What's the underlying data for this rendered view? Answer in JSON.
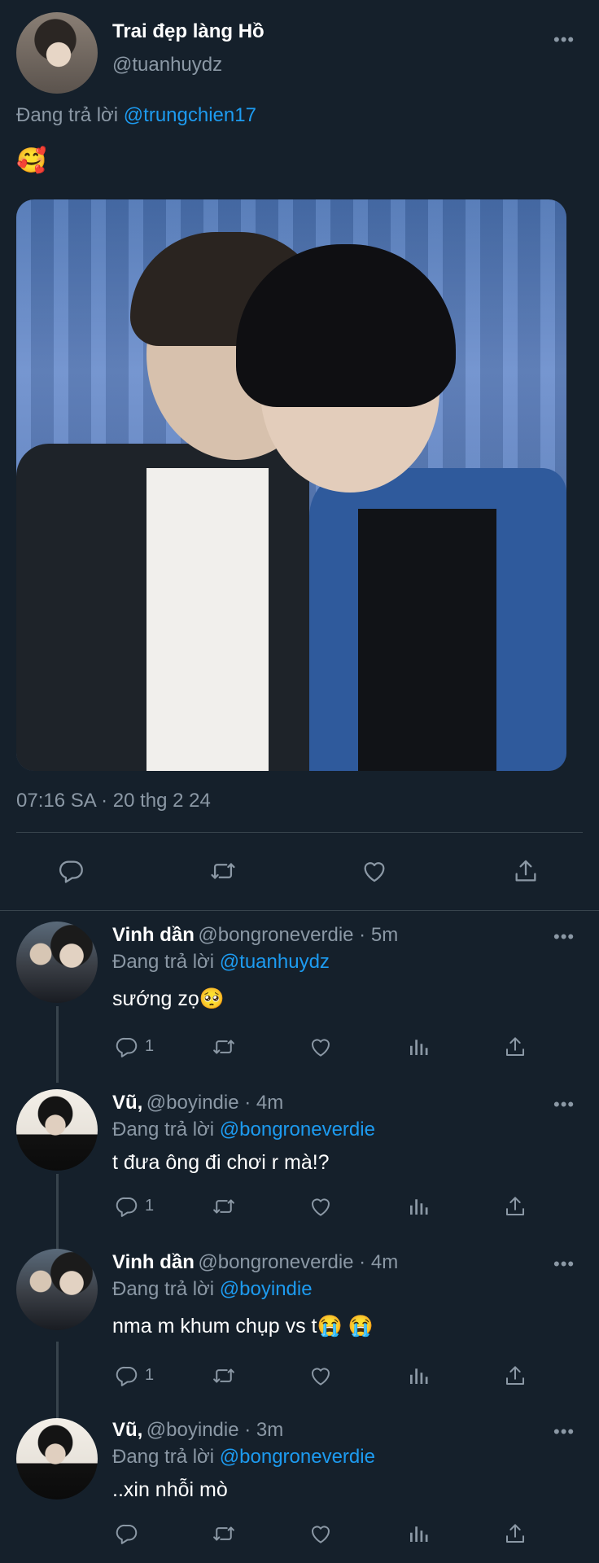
{
  "main_tweet": {
    "display_name": "Trai đẹp làng Hồ",
    "handle": "@tuanhuydz",
    "replying_prefix": "Đang trả lời",
    "replying_to": "@trungchien17",
    "text": "🥰",
    "timestamp": "07:16 SA · 20 thg 2 24",
    "more": "•••"
  },
  "replies": [
    {
      "display_name": "Vinh dần",
      "handle_time": "@bongroneverdie · 5m",
      "replying_prefix": "Đang trả lời",
      "replying_to": "@tuanhuydz",
      "text": "sướng zọ🥺",
      "reply_count": "1",
      "more": "•••"
    },
    {
      "display_name": "Vũ,",
      "handle_time": "@boyindie · 4m",
      "replying_prefix": "Đang trả lời",
      "replying_to": "@bongroneverdie",
      "text": "t đưa ông đi chơi r mà!?",
      "reply_count": "1",
      "more": "•••"
    },
    {
      "display_name": "Vinh dần",
      "handle_time": "@bongroneverdie · 4m",
      "replying_prefix": "Đang trả lời",
      "replying_to": "@boyindie",
      "text": "nma m khum chụp vs t😭 😭",
      "reply_count": "1",
      "more": "•••"
    },
    {
      "display_name": "Vũ,",
      "handle_time": "@boyindie · 3m",
      "replying_prefix": "Đang trả lời",
      "replying_to": "@bongroneverdie",
      "text": "..xin nhỗi mò",
      "reply_count": "",
      "more": "•••"
    }
  ],
  "icons": {
    "reply": "reply-icon",
    "retweet": "retweet-icon",
    "like": "heart-icon",
    "share": "share-icon",
    "views": "views-icon"
  },
  "colors": {
    "background": "#15202b",
    "link": "#1d9bf0",
    "muted": "#8b98a5",
    "divider": "#38444d"
  }
}
